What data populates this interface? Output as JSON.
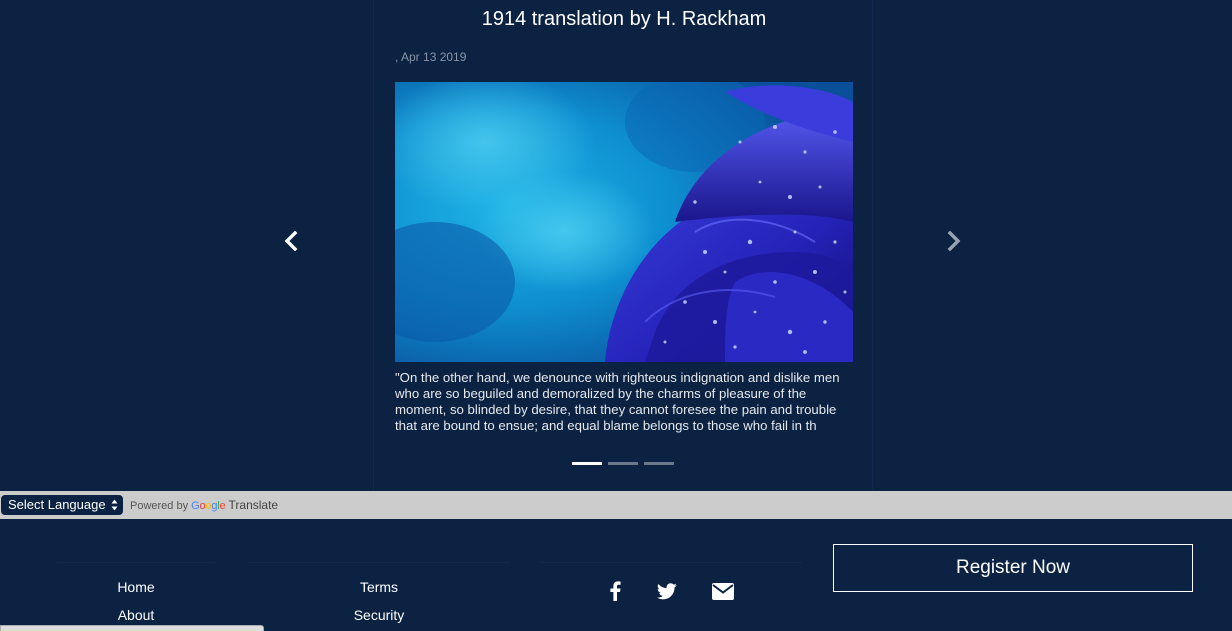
{
  "carousel": {
    "title": "1914 translation by H. Rackham",
    "meta": ", Apr 13 2019",
    "image_icon": "blue-rose-photo",
    "excerpt": "\"On the other hand, we denounce with righteous indignation and dislike men who are so beguiled and demoralized by the charms of pleasure of the moment, so blinded by desire, that they cannot foresee the pain and trouble that are bound to ensue; and equal blame belongs to those who fail in th",
    "slides_count": 3,
    "active_slide": 1,
    "prev_icon": "chevron-left-icon",
    "next_icon": "chevron-right-icon"
  },
  "translate": {
    "select_label": "Select Language",
    "powered_by": "Powered by",
    "google": [
      "G",
      "o",
      "o",
      "g",
      "l",
      "e"
    ],
    "google_colors": [
      "#4285f4",
      "#ea4335",
      "#fbbc05",
      "#4285f4",
      "#34a853",
      "#ea4335"
    ],
    "translate_label": "Translate"
  },
  "footer": {
    "col1": [
      "Home",
      "About"
    ],
    "col2": [
      "Terms",
      "Security"
    ],
    "social": [
      "facebook-icon",
      "twitter-icon",
      "envelope-icon"
    ],
    "register_label": "Register Now"
  },
  "colors": {
    "background": "#0b2242",
    "translate_bar": "#cccccc",
    "indicator_active": "#ffffff",
    "indicator_inactive": "#6b7889"
  }
}
